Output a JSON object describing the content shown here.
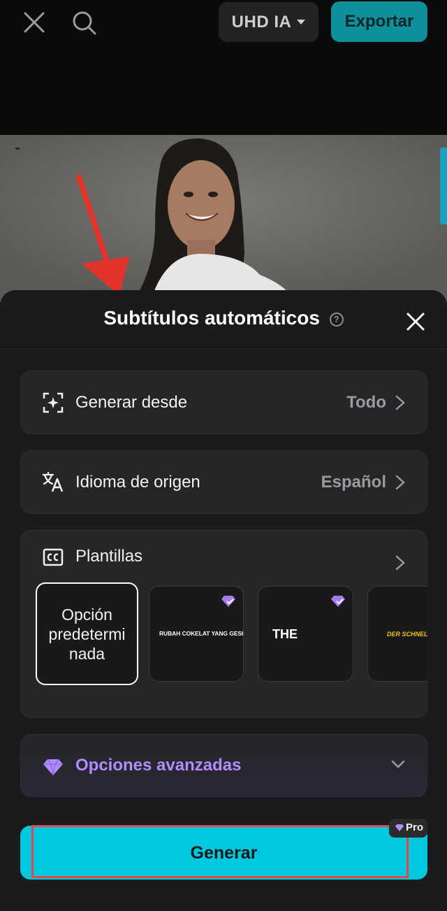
{
  "topbar": {
    "quality_label": "UHD IA",
    "export_label": "Exportar",
    "icons": {
      "close": "close-icon",
      "search": "search-icon",
      "dropdown": "caret-down-icon"
    }
  },
  "sheet": {
    "title": "Subtítulos automáticos",
    "help_glyph": "?",
    "rows": [
      {
        "label": "Generar desde",
        "value": "Todo",
        "icon": "ai-frame-icon"
      },
      {
        "label": "Idioma de origen",
        "value": "Español",
        "icon": "translate-icon"
      }
    ],
    "templates": {
      "label": "Plantillas",
      "icon": "closed-caption-icon",
      "items": [
        {
          "label": "Opción predetermi nada",
          "selected": true,
          "pro": false
        },
        {
          "label": "RUBAH COKELAT YANG GESIT",
          "pro": true
        },
        {
          "label": "THE",
          "pro": true
        },
        {
          "label": "DER SCHNELLE B",
          "pro": false
        }
      ]
    },
    "advanced": {
      "label": "Opciones avanzadas",
      "icon": "diamond-icon"
    },
    "generate": {
      "label": "Generar",
      "pro_badge": "Pro"
    }
  },
  "colors": {
    "accent": "#01c8de",
    "export_bg": "#0e8f9a",
    "advanced_text": "#b28cff",
    "highlight_frame": "#e0464a",
    "arrow": "#e5332a"
  }
}
